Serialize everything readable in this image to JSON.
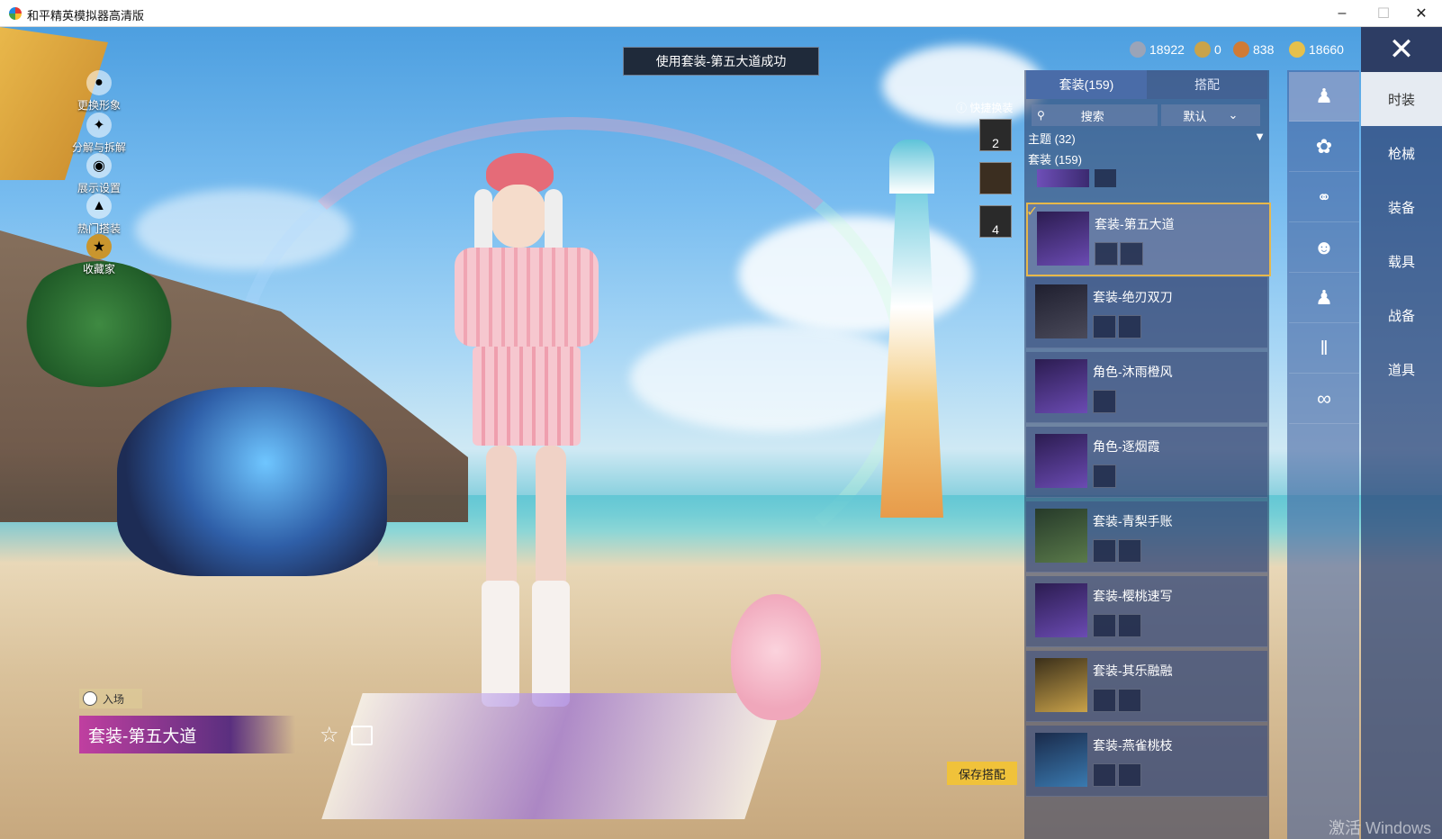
{
  "window": {
    "title": "和平精英模拟器高清版"
  },
  "toast": "使用套装-第五大道成功",
  "currencies": [
    {
      "icon": "silver-coin-icon",
      "value": "18922",
      "color": "#9aa4b8"
    },
    {
      "icon": "gold-token-icon",
      "value": "0",
      "color": "#c9a34a"
    },
    {
      "icon": "bronze-coin-icon",
      "value": "838",
      "color": "#d07b35"
    },
    {
      "icon": "gold-coin-icon",
      "value": "18660",
      "color": "#e6c04b"
    }
  ],
  "left_menu": [
    {
      "icon": "person-icon",
      "label": "更换形象"
    },
    {
      "icon": "decompose-icon",
      "label": "分解与拆解"
    },
    {
      "icon": "eye-icon",
      "label": "展示设置"
    },
    {
      "icon": "fire-icon",
      "label": "热门搭装"
    },
    {
      "icon": "badge-icon",
      "label": "收藏家"
    }
  ],
  "entrance": {
    "badge": "入场",
    "outfit_name": "套装-第五大道"
  },
  "quick_change": {
    "label": "快捷换装",
    "slot1": "2",
    "slot3": "4"
  },
  "panel": {
    "tabs": [
      {
        "label": "套装(159)",
        "active": true
      },
      {
        "label": "搭配",
        "active": false
      }
    ],
    "search_placeholder": "搜索",
    "sort_value": "默认",
    "theme_label": "主题 (32)",
    "suit_label": "套装 (159)",
    "items": [
      {
        "name": "套装-第五大道",
        "selected": true
      },
      {
        "name": "套装-绝刃双刀",
        "selected": false
      },
      {
        "name": "角色-沐雨橙风",
        "selected": false
      },
      {
        "name": "角色-逐烟霞",
        "selected": false
      },
      {
        "name": "套装-青梨手账",
        "selected": false
      },
      {
        "name": "套装-樱桃速写",
        "selected": false
      },
      {
        "name": "套装-其乐融融",
        "selected": false
      },
      {
        "name": "套装-燕雀桃枝",
        "selected": false
      }
    ]
  },
  "category_icons": [
    "outfit-icon",
    "hair-icon",
    "glasses-icon",
    "mask-icon",
    "top-icon",
    "pants-icon",
    "shoes-icon"
  ],
  "right_tabs": [
    {
      "label": "时装",
      "active": true
    },
    {
      "label": "枪械",
      "active": false
    },
    {
      "label": "装备",
      "active": false
    },
    {
      "label": "载具",
      "active": false
    },
    {
      "label": "战备",
      "active": false
    },
    {
      "label": "道具",
      "active": false
    }
  ],
  "save_button": "保存搭配",
  "watermark": "激活 Windows"
}
